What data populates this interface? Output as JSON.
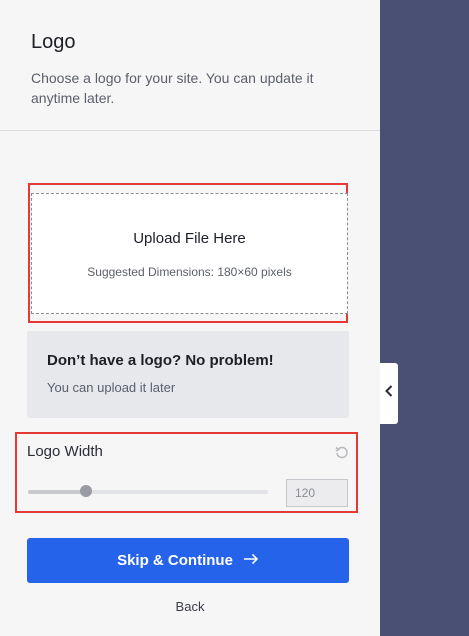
{
  "header": {
    "title": "Logo",
    "subtitle": "Choose a logo for your site. You can update it anytime later."
  },
  "upload": {
    "title": "Upload File Here",
    "hint": "Suggested Dimensions: 180×60 pixels"
  },
  "no_logo": {
    "title": "Don’t have a logo? No problem!",
    "subtitle": "You can upload it later"
  },
  "logo_width": {
    "label": "Logo Width",
    "value": "120",
    "slider_fraction": 0.24,
    "icons": {
      "reset": "reset-icon"
    }
  },
  "actions": {
    "primary_label": "Skip & Continue",
    "primary_icon": "arrow-right-icon",
    "back_label": "Back"
  },
  "sidebar_toggle": {
    "icon": "chevron-left-icon"
  },
  "colors": {
    "primary": "#2563eb",
    "highlight": "#e53935",
    "panel_bg": "#f6f6f7",
    "canvas_bg": "#4a5074"
  }
}
